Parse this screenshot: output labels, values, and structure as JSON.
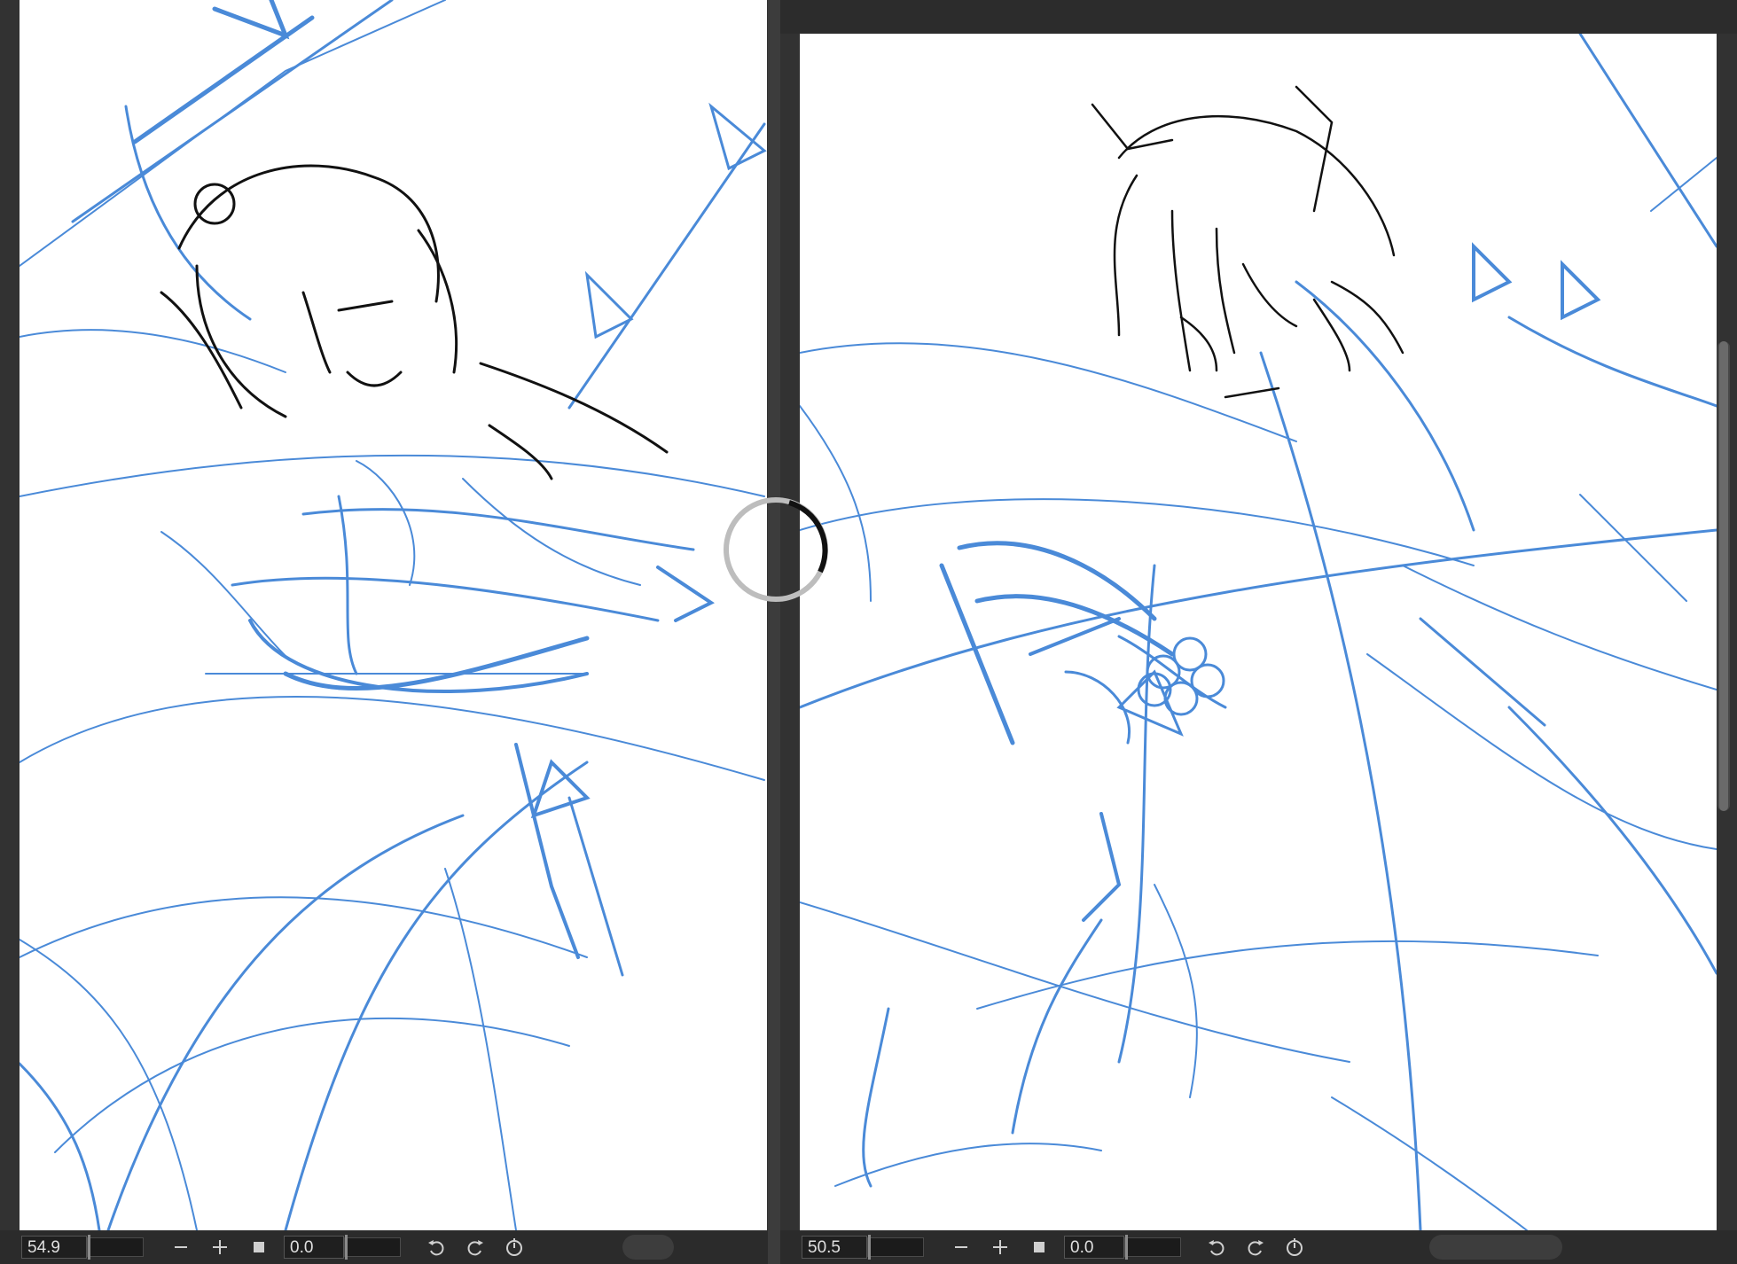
{
  "left_view": {
    "zoom_value": "54.9",
    "rotation_value": "0.0",
    "zoom_out_icon": "minus-icon",
    "zoom_in_icon": "plus-icon",
    "fit_icon": "square-icon",
    "rotate_left_icon": "rotate-ccw-icon",
    "rotate_right_icon": "rotate-cw-icon",
    "reset_rotation_icon": "reset-rotation-icon"
  },
  "right_view": {
    "zoom_value": "50.5",
    "rotation_value": "0.0",
    "zoom_out_icon": "minus-icon",
    "zoom_in_icon": "plus-icon",
    "fit_icon": "square-icon",
    "rotate_left_icon": "rotate-ccw-icon",
    "rotate_right_icon": "rotate-cw-icon",
    "reset_rotation_icon": "reset-rotation-icon"
  },
  "colors": {
    "sketch_blue": "#4a8ad8",
    "ink_black": "#111111",
    "canvas": "#ffffff",
    "chrome_dark": "#2b2b2b"
  }
}
